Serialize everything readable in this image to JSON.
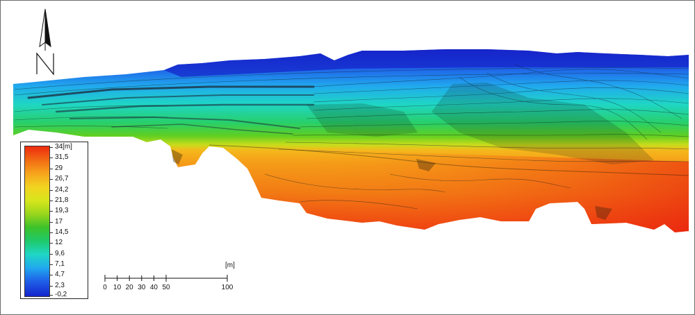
{
  "map": {
    "north_label": "N",
    "legend": {
      "unit": "[m]",
      "ticks": [
        "34",
        "31,5",
        "29",
        "26,7",
        "24,2",
        "21,8",
        "19,3",
        "17",
        "14,5",
        "12",
        "9,6",
        "7,1",
        "4,7",
        "2,3",
        "-0,2"
      ]
    },
    "scale": {
      "unit": "[m]",
      "labels": [
        "0",
        "10",
        "20",
        "30",
        "40",
        "50",
        "100"
      ]
    },
    "colors": {
      "high": "#ee2a10",
      "mid_high": "#f7a41c",
      "mid": "#3dc22a",
      "mid_low": "#1fd6c4",
      "low": "#1424cc"
    }
  }
}
